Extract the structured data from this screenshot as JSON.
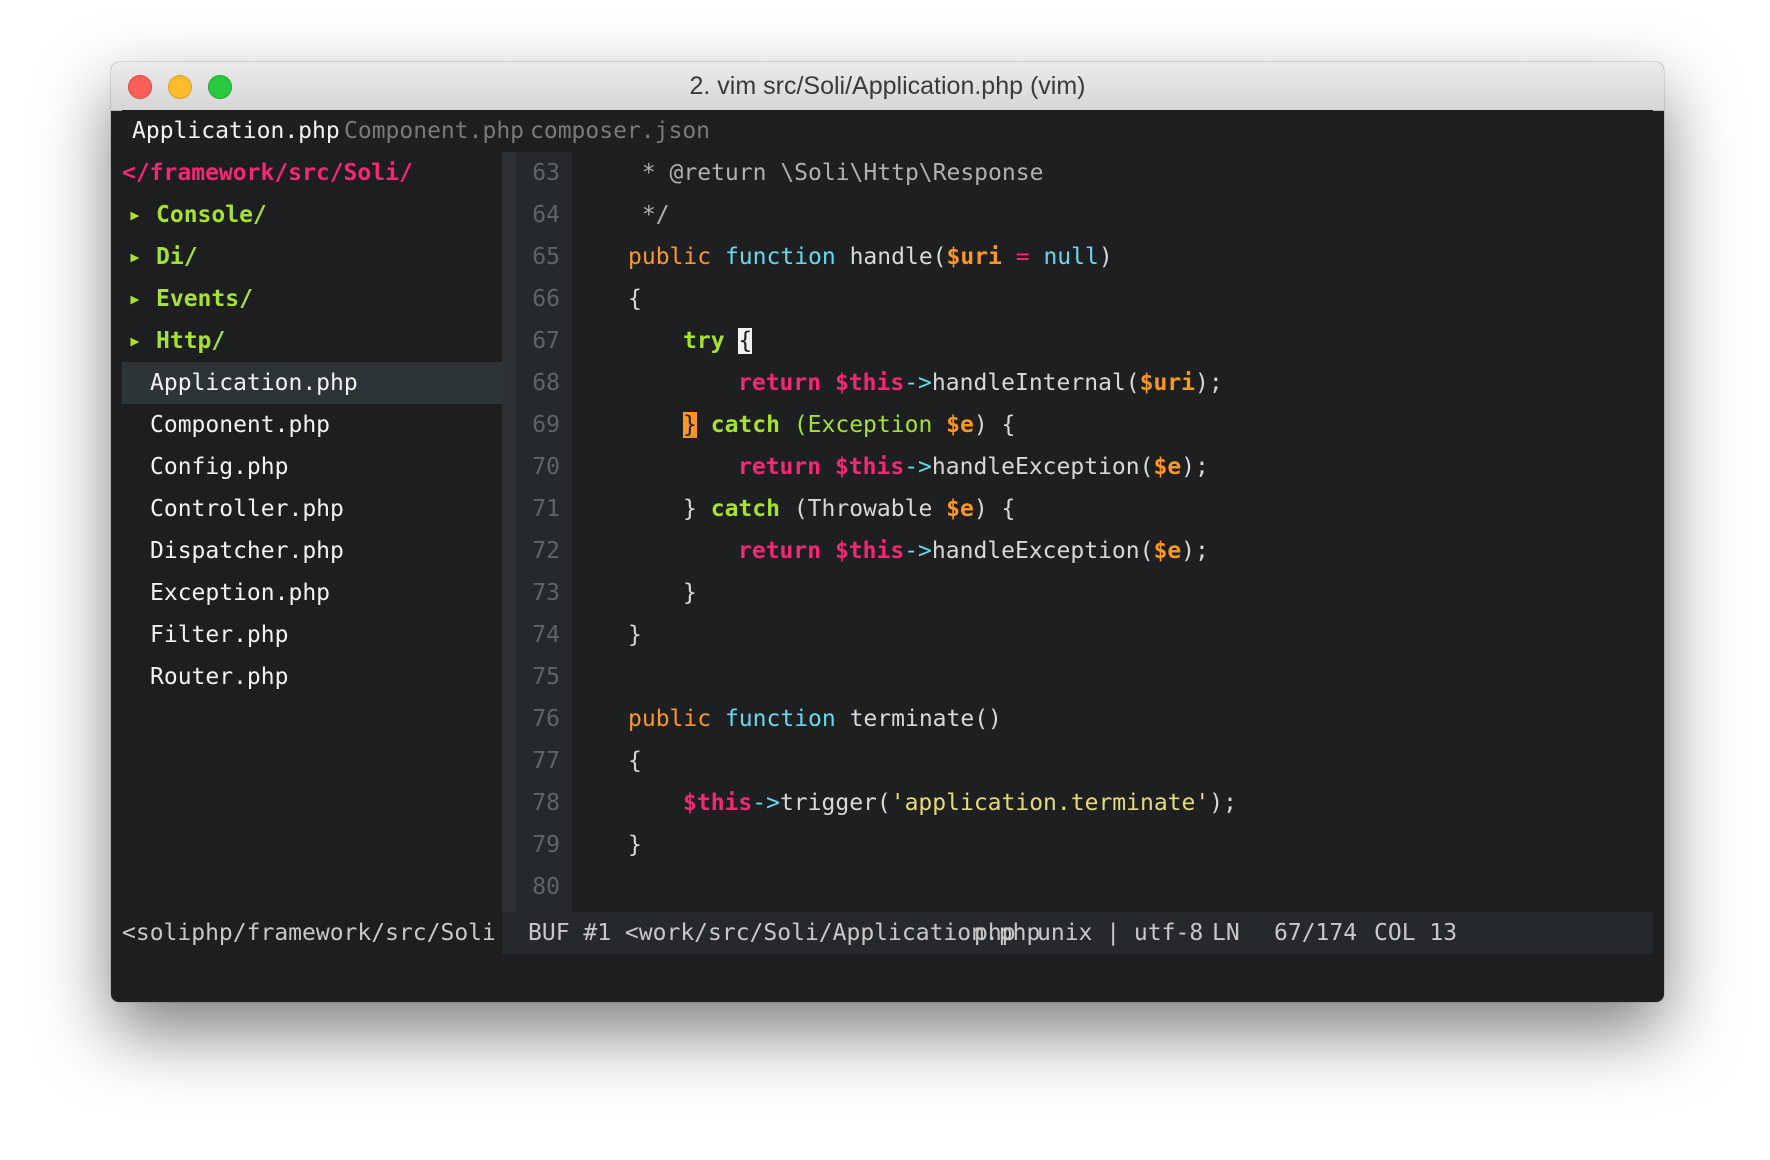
{
  "window": {
    "title": "2. vim src/Soli/Application.php (vim)"
  },
  "tabs": [
    {
      "label": "Application.php",
      "active": true
    },
    {
      "label": "Component.php",
      "active": false
    },
    {
      "label": "composer.json",
      "active": false
    }
  ],
  "tree": {
    "root": "</framework/src/Soli/",
    "arrow_icon": "▸",
    "dirs": [
      "Console/",
      "Di/",
      "Events/",
      "Http/"
    ],
    "files": [
      "Application.php",
      "Component.php",
      "Config.php",
      "Controller.php",
      "Dispatcher.php",
      "Exception.php",
      "Filter.php",
      "Router.php"
    ],
    "selected_file": "Application.php"
  },
  "editor": {
    "line_numbers": [
      "63",
      "64",
      "65",
      "66",
      "67",
      "68",
      "69",
      "70",
      "71",
      "72",
      "73",
      "74",
      "75",
      "76",
      "77",
      "78",
      "79",
      "80"
    ],
    "tokens": {
      "comment_return": " * @return \\Soli\\Http\\Response",
      "comment_end": " */",
      "public": "public",
      "function": "function",
      "handle": " handle(",
      "uri_var": "$uri",
      "eq": " = ",
      "null": "null",
      "rparen": ")",
      "open_brace": "{",
      "close_brace": "}",
      "try": "try",
      "return": "return",
      "this": "$this",
      "arrow": "->",
      "handleInternal": "handleInternal(",
      "semicolon_paren": ");",
      "catch": "catch",
      "exception_open": " (Exception ",
      "throwable_open": " (Throwable ",
      "e_var": "$e",
      "paren_brace": ") {",
      "handleException": "handleException(",
      "terminate": " terminate()",
      "trigger": "trigger(",
      "terminate_str": "'application.terminate'"
    }
  },
  "statusline": {
    "left": "<soliphp/framework/src/Soli",
    "buf": "BUF #1 <work/src/Soli/Application.php",
    "filetype": "php",
    "format": "unix | utf-8",
    "ln_label": "LN",
    "position": "67/174",
    "col": "COL 13"
  }
}
